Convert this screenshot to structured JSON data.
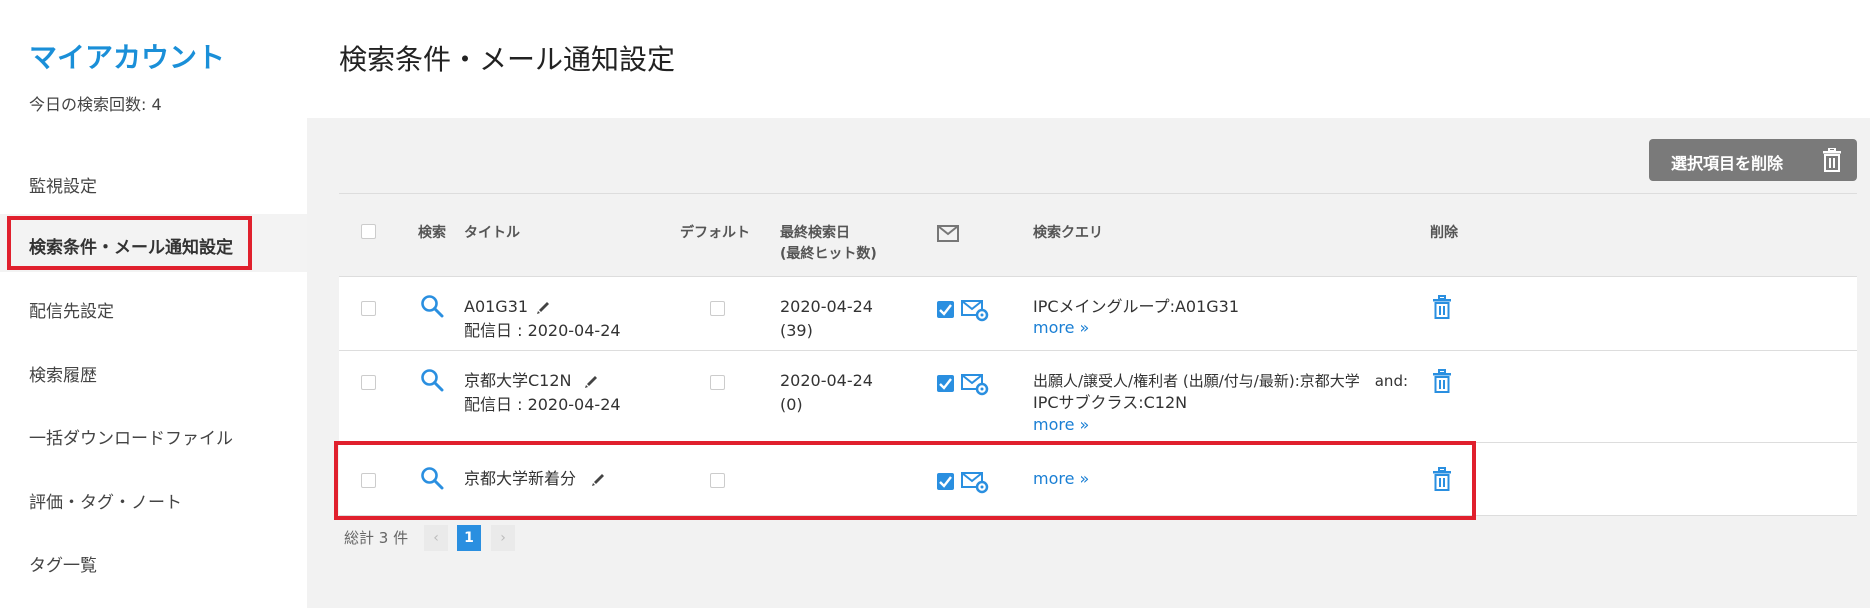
{
  "sidebar": {
    "title": "マイアカウント",
    "search_count": "今日の検索回数: 4",
    "items": [
      {
        "label": "監視設定"
      },
      {
        "label": "検索条件・メール通知設定"
      },
      {
        "label": "配信先設定"
      },
      {
        "label": "検索履歴"
      },
      {
        "label": "一括ダウンロードファイル"
      },
      {
        "label": "評価・タグ・ノート"
      },
      {
        "label": "タグ一覧"
      }
    ]
  },
  "page_title": "検索条件・メール通知設定",
  "delete_selected_label": "選択項目を削除",
  "table": {
    "headers": {
      "search": "検索",
      "title": "タイトル",
      "default": "デフォルト",
      "last_search_1": "最終検索日",
      "last_search_2": "(最終ヒット数)",
      "query": "検索クエリ",
      "delete": "削除"
    },
    "rows": [
      {
        "title": "A01G31",
        "delivery": "配信日 : 2020-04-24",
        "last_date": "2020-04-24",
        "hits": "(39)",
        "query_1": "IPCメイングループ:A01G31",
        "query_2": "",
        "more": "more »"
      },
      {
        "title": "京都大学C12N",
        "delivery": "配信日 : 2020-04-24",
        "last_date": "2020-04-24",
        "hits": "(0)",
        "query_1": "出願人/譲受人/権利者 (出願/付与/最新):京都大学　and:",
        "query_2": "IPCサブクラス:C12N",
        "more": "more »"
      },
      {
        "title": "京都大学新着分",
        "delivery": "",
        "last_date": "",
        "hits": "",
        "query_1": "",
        "query_2": "",
        "more": "more »"
      }
    ]
  },
  "pagination": {
    "total": "総計 3 件",
    "prev": "‹",
    "current": "1",
    "next": "›"
  },
  "colors": {
    "accent": "#1a8fd8",
    "highlight": "#e0202d",
    "checkbox_checked": "#2a8fe0"
  }
}
